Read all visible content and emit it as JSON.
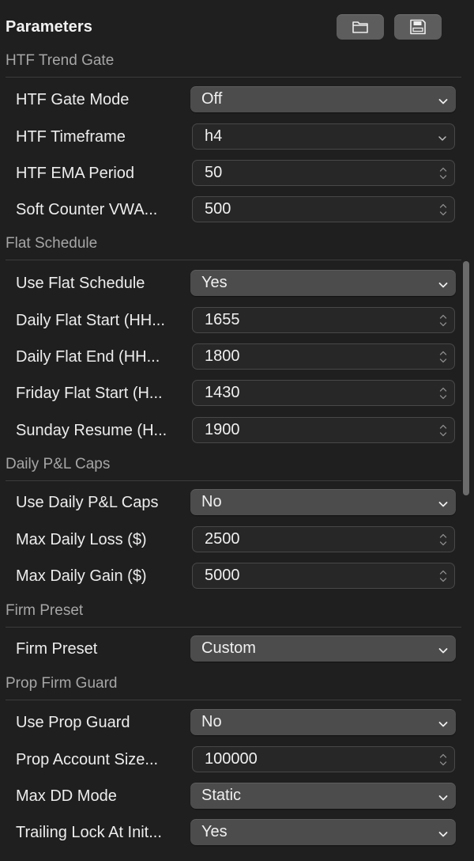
{
  "header": {
    "title": "Parameters",
    "open_icon": "folder-icon",
    "save_icon": "floppy-disk-icon"
  },
  "sections": [
    {
      "title": "HTF Trend Gate",
      "rows": [
        {
          "label": "HTF Gate Mode",
          "type": "popup",
          "value": "Off"
        },
        {
          "label": "HTF Timeframe",
          "type": "combo",
          "value": "h4"
        },
        {
          "label": "HTF EMA Period",
          "type": "number",
          "value": "50"
        },
        {
          "label": "Soft Counter VWA...",
          "type": "number",
          "value": "500"
        }
      ]
    },
    {
      "title": "Flat Schedule",
      "rows": [
        {
          "label": "Use Flat Schedule",
          "type": "popup",
          "value": "Yes"
        },
        {
          "label": "Daily Flat Start (HH...",
          "type": "number",
          "value": "1655"
        },
        {
          "label": "Daily Flat End (HH...",
          "type": "number",
          "value": "1800"
        },
        {
          "label": "Friday Flat Start (H...",
          "type": "number",
          "value": "1430"
        },
        {
          "label": "Sunday Resume (H...",
          "type": "number",
          "value": "1900"
        }
      ]
    },
    {
      "title": "Daily P&L Caps",
      "rows": [
        {
          "label": "Use Daily P&L Caps",
          "type": "popup",
          "value": "No"
        },
        {
          "label": "Max Daily Loss ($)",
          "type": "number",
          "value": "2500"
        },
        {
          "label": "Max Daily Gain ($)",
          "type": "number",
          "value": "5000"
        }
      ]
    },
    {
      "title": "Firm Preset",
      "rows": [
        {
          "label": "Firm Preset",
          "type": "popup",
          "value": "Custom"
        }
      ]
    },
    {
      "title": "Prop Firm Guard",
      "rows": [
        {
          "label": "Use Prop Guard",
          "type": "popup",
          "value": "No"
        },
        {
          "label": "Prop Account Size...",
          "type": "number",
          "value": "100000"
        },
        {
          "label": "Max DD Mode",
          "type": "popup",
          "value": "Static"
        },
        {
          "label": "Trailing Lock At Init...",
          "type": "popup",
          "value": "Yes"
        }
      ]
    }
  ],
  "scrollbar": {
    "thumb_fraction": 0.29
  }
}
